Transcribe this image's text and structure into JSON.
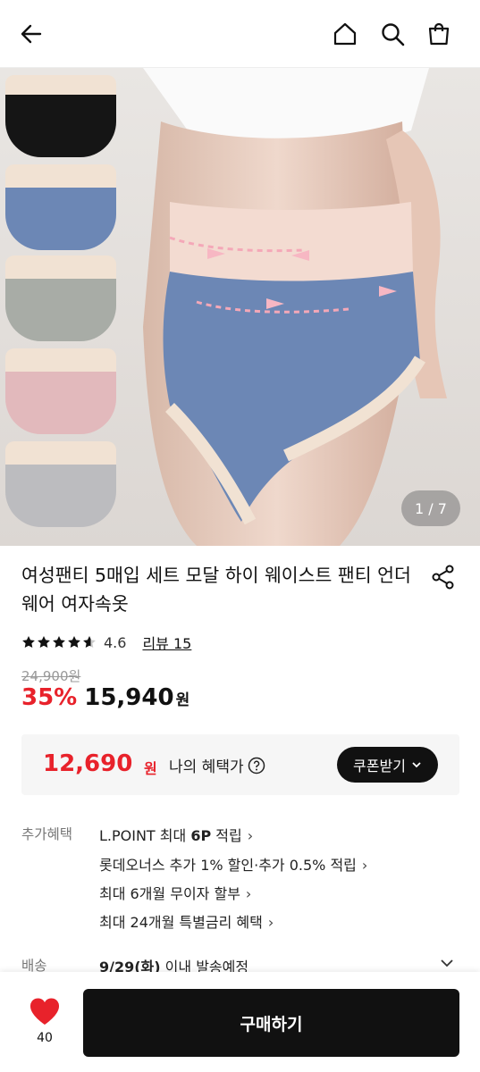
{
  "header": {
    "back_icon": "back-arrow-icon",
    "home_icon": "home-icon",
    "search_icon": "search-icon",
    "cart_icon": "shopping-bag-icon"
  },
  "gallery": {
    "counter": "1 / 7",
    "swatch_colors": [
      "#151515",
      "#6c87b5",
      "#a8aca6",
      "#e2b9bc",
      "#bcbcbf"
    ],
    "band_color": "#f1e2d3"
  },
  "product": {
    "title": "여성팬티 5매입 세트 모달 하이 웨이스트 팬티 언더웨어 여자속옷",
    "rating": "4.6",
    "rating_stars": 4.6,
    "review_label": "리뷰 15",
    "original_price": "24,900원",
    "discount": "35%",
    "price": "15,940",
    "price_unit": "원"
  },
  "benefit": {
    "price": "12,690",
    "unit": "원",
    "label": "나의 혜택가",
    "coupon_button": "쿠폰받기"
  },
  "extra": {
    "label": "추가혜택",
    "lines": [
      {
        "pre": "L.POINT 최대 ",
        "bold": "6P",
        "post": " 적립"
      },
      {
        "pre": "롯데오너스 추가 1% 할인·추가 0.5% 적립",
        "bold": "",
        "post": ""
      },
      {
        "pre": "최대 6개월 무이자 할부",
        "bold": "",
        "post": ""
      },
      {
        "pre": "최대 24개월 특별금리 혜택",
        "bold": "",
        "post": ""
      }
    ]
  },
  "shipping": {
    "label": "배송",
    "date": "9/29(화)",
    "text": " 이내 발송예정"
  },
  "bottom_bar": {
    "wish_count": "40",
    "buy_label": "구매하기"
  },
  "colors": {
    "accent_red": "#e8222b",
    "dark": "#111111"
  }
}
